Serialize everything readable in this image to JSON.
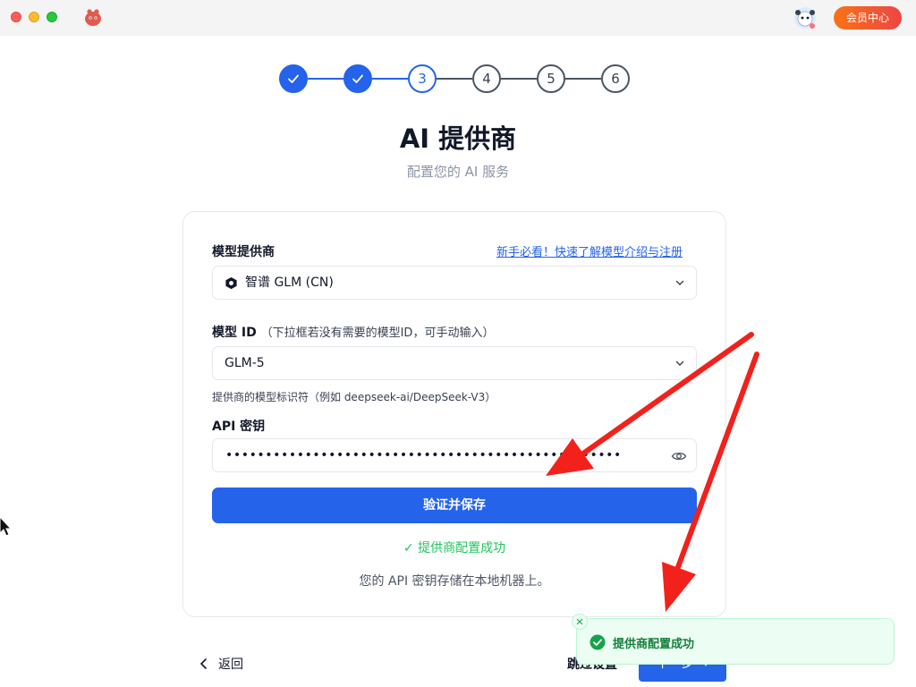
{
  "app": {
    "member_button": "会员中心"
  },
  "stepper": {
    "steps": [
      {
        "label": "✓",
        "state": "done"
      },
      {
        "label": "✓",
        "state": "done"
      },
      {
        "label": "3",
        "state": "active"
      },
      {
        "label": "4",
        "state": "todo"
      },
      {
        "label": "5",
        "state": "todo"
      },
      {
        "label": "6",
        "state": "todo"
      }
    ]
  },
  "header": {
    "title": "AI 提供商",
    "subtitle": "配置您的 AI 服务"
  },
  "form": {
    "provider_label": "模型提供商",
    "provider_link": "新手必看！快速了解模型介绍与注册",
    "provider_value": "智谱 GLM (CN)",
    "model_label": "模型 ID",
    "model_hint": "（下拉框若没有需要的模型ID，可手动输入）",
    "model_value": "GLM-5",
    "model_helper": "提供商的模型标识符（例如 deepseek-ai/DeepSeek-V3）",
    "api_label": "API 密钥",
    "api_value": "••••••••••••••••••••••••••••••••••••••••••••••••••",
    "verify_button": "验证并保存",
    "success_text": "✓ 提供商配置成功",
    "storage_note": "您的 API 密钥存储在本地机器上。"
  },
  "nav": {
    "back": "返回",
    "skip": "跳过设置",
    "next": "下一步 →"
  },
  "toast": {
    "text": "提供商配置成功"
  },
  "colors": {
    "primary": "#2563eb",
    "success": "#22c55e",
    "member_gradient": "#f97316-#ef4444"
  }
}
